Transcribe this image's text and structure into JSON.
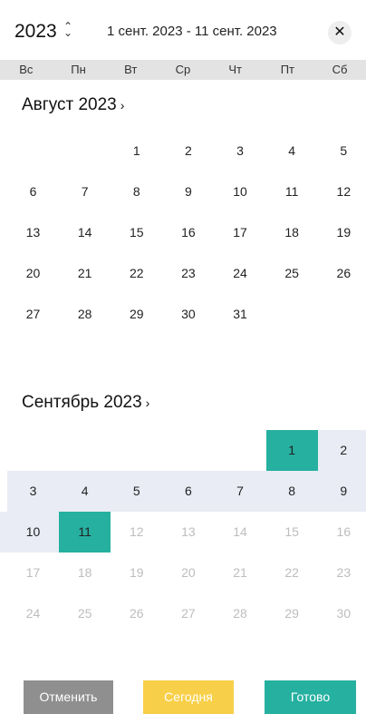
{
  "header": {
    "year": "2023",
    "year_toggle_glyph": "⌃⌄",
    "range_label": "1 сент. 2023 - 11 сент. 2023",
    "close_glyph": "✕"
  },
  "weekdays": [
    "Вс",
    "Пн",
    "Вт",
    "Ср",
    "Чт",
    "Пт",
    "Сб"
  ],
  "months": [
    {
      "title": "Август 2023",
      "chevron": "›",
      "weeks": [
        [
          {
            "d": ""
          },
          {
            "d": ""
          },
          {
            "d": "1"
          },
          {
            "d": "2"
          },
          {
            "d": "3"
          },
          {
            "d": "4"
          },
          {
            "d": "5"
          }
        ],
        [
          {
            "d": "6"
          },
          {
            "d": "7"
          },
          {
            "d": "8"
          },
          {
            "d": "9"
          },
          {
            "d": "10"
          },
          {
            "d": "11"
          },
          {
            "d": "12"
          }
        ],
        [
          {
            "d": "13"
          },
          {
            "d": "14"
          },
          {
            "d": "15"
          },
          {
            "d": "16"
          },
          {
            "d": "17"
          },
          {
            "d": "18"
          },
          {
            "d": "19"
          }
        ],
        [
          {
            "d": "20"
          },
          {
            "d": "21"
          },
          {
            "d": "22"
          },
          {
            "d": "23"
          },
          {
            "d": "24"
          },
          {
            "d": "25"
          },
          {
            "d": "26"
          }
        ],
        [
          {
            "d": "27"
          },
          {
            "d": "28"
          },
          {
            "d": "29"
          },
          {
            "d": "30"
          },
          {
            "d": "31"
          },
          {
            "d": ""
          },
          {
            "d": ""
          }
        ]
      ]
    },
    {
      "title": "Сентябрь 2023",
      "chevron": "›",
      "weeks": [
        [
          {
            "d": ""
          },
          {
            "d": ""
          },
          {
            "d": ""
          },
          {
            "d": ""
          },
          {
            "d": ""
          },
          {
            "d": "1",
            "state": "selected"
          },
          {
            "d": "2",
            "state": "inrange"
          }
        ],
        [
          {
            "d": "3",
            "state": "inrange"
          },
          {
            "d": "4",
            "state": "inrange"
          },
          {
            "d": "5",
            "state": "inrange"
          },
          {
            "d": "6",
            "state": "inrange"
          },
          {
            "d": "7",
            "state": "inrange"
          },
          {
            "d": "8",
            "state": "inrange"
          },
          {
            "d": "9",
            "state": "inrange"
          }
        ],
        [
          {
            "d": "10",
            "state": "inrange"
          },
          {
            "d": "11",
            "state": "selected"
          },
          {
            "d": "12",
            "state": "disabled"
          },
          {
            "d": "13",
            "state": "disabled"
          },
          {
            "d": "14",
            "state": "disabled"
          },
          {
            "d": "15",
            "state": "disabled"
          },
          {
            "d": "16",
            "state": "disabled"
          }
        ],
        [
          {
            "d": "17",
            "state": "disabled"
          },
          {
            "d": "18",
            "state": "disabled"
          },
          {
            "d": "19",
            "state": "disabled"
          },
          {
            "d": "20",
            "state": "disabled"
          },
          {
            "d": "21",
            "state": "disabled"
          },
          {
            "d": "22",
            "state": "disabled"
          },
          {
            "d": "23",
            "state": "disabled"
          }
        ],
        [
          {
            "d": "24",
            "state": "disabled"
          },
          {
            "d": "25",
            "state": "disabled"
          },
          {
            "d": "26",
            "state": "disabled"
          },
          {
            "d": "27",
            "state": "disabled"
          },
          {
            "d": "28",
            "state": "disabled"
          },
          {
            "d": "29",
            "state": "disabled"
          },
          {
            "d": "30",
            "state": "disabled"
          }
        ]
      ]
    }
  ],
  "buttons": {
    "cancel": "Отменить",
    "today": "Сегодня",
    "done": "Готово"
  },
  "colors": {
    "accent": "#26b0a0",
    "today": "#f8cf48",
    "cancel": "#8f8f8f",
    "range_band": "#e9ecf4"
  }
}
